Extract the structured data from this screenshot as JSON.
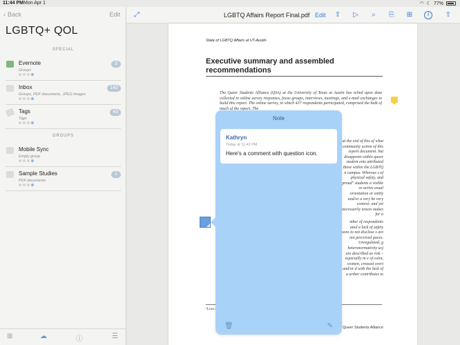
{
  "status": {
    "time": "11:44 PM",
    "date": "Mon Apr 1",
    "battery": "77%"
  },
  "sidebar": {
    "back_label": "Back",
    "edit_label": "Edit",
    "title": "LGBTQ+ QOL",
    "sections": {
      "special": "SPECIAL",
      "groups": "GROUPS"
    },
    "items": [
      {
        "name": "Evernote",
        "sub": "Groups",
        "badge": "3",
        "color": "#7fb77e"
      },
      {
        "name": "Inbox",
        "sub": "Groups, PDF documents, JPEG images",
        "badge": "142",
        "color": "#dcdcd8"
      },
      {
        "name": "Tags",
        "sub": "Tags",
        "badge": "43",
        "color": "#dcdcd8"
      },
      {
        "name": "Mobile Sync",
        "sub": "Empty group",
        "badge": "",
        "color": "#dcdcd8"
      },
      {
        "name": "Sample Studies",
        "sub": "PDF documents",
        "badge": "1",
        "color": "#dcdcd8"
      }
    ]
  },
  "toolbar": {
    "title": "LGBTQ Affairs Report Final.pdf",
    "edit_label": "Edit"
  },
  "document": {
    "header": "State of LGBTQ Affairs at UT-Austin",
    "heading": "Executive summary and assembled recommendations",
    "body": "The Queer Students Alliance (QSA) at the University of Texas at Austin has relied upon data collected in online survey responses, focus groups, interviews, meetings, and e-mail exchanges to build this report. The online survey, in which 437 respondents participated, comprised the bulk of much of the report. The",
    "right_col": "at the end of this of what community uction of this report document. but disappoint within queer student ents attributed these within the LGBTQ n campus. Whereas s of physical safety, and proud\" students a visible or active exual orientation or entity and/or a very be very context- and yet necessarily iences makes for a",
    "right_col2": "mber of respondents ated a lack of safety sons to not disclose s are not perceived paces. Unregulated, g heteronormativity us) are described as risk – especially in e of color, women, creased overt and/or d with the lack of a urther contributes to",
    "footnote": "¹Loss and ro... enforced gender norms",
    "footer": "Queer Students Alliance"
  },
  "note": {
    "title": "Note",
    "author": "Kathryn",
    "time": "Today at 11:42 PM",
    "text": "Here's a comment with question icon."
  }
}
